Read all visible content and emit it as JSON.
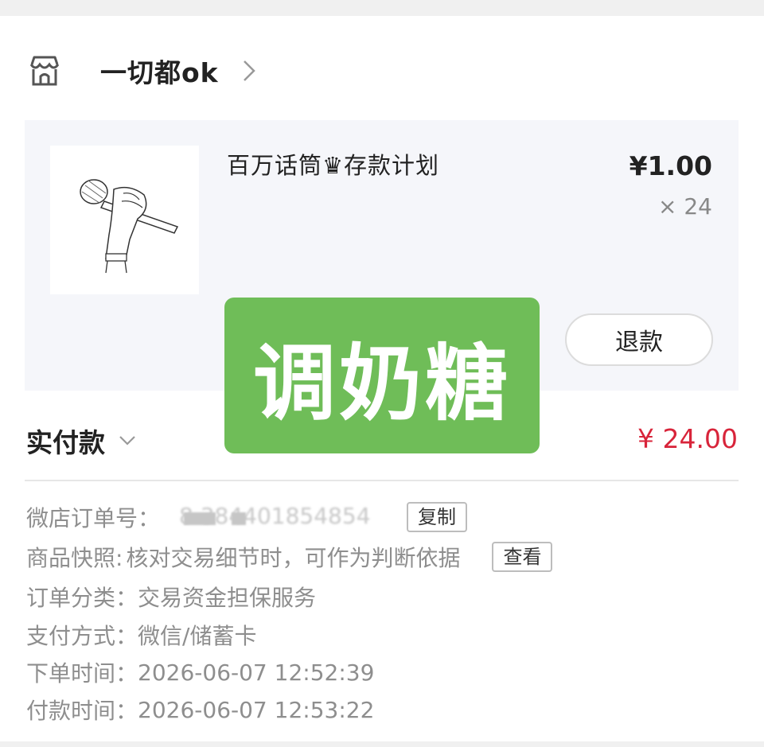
{
  "shop": {
    "name": "一切都ok",
    "icon": "store-icon"
  },
  "product": {
    "title": "百万话筒♛存款计划",
    "price": "¥1.00",
    "quantity": "× 24",
    "image": "microphone-hand-image",
    "refund_label": "退款"
  },
  "payment": {
    "label": "实付款",
    "amount": "¥ 24.00"
  },
  "details": {
    "order_no_label": "微店订单号：",
    "order_no_value": "8  384401854854",
    "copy_label": "复制",
    "snapshot_label": "商品快照:",
    "snapshot_value": "核对交易细节时，可作为判断依据",
    "view_label": "查看",
    "category_label": "订单分类：",
    "category_value": "交易资金担保服务",
    "pay_method_label": "支付方式：",
    "pay_method_value": "微信/储蓄卡",
    "order_time_label": "下单时间：",
    "order_time_value": "2026-06-07 12:52:39",
    "pay_time_label": "付款时间：",
    "pay_time_value": "2026-06-07 12:53:22"
  },
  "watermark": {
    "text": "调奶糖",
    "color": "#6fbd58"
  },
  "colors": {
    "price_accent": "#d8243a"
  }
}
